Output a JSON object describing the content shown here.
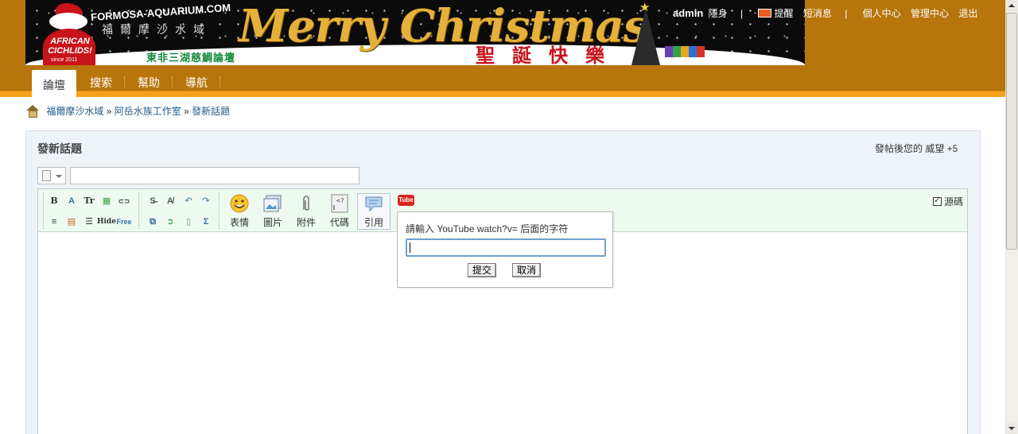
{
  "banner": {
    "site_url": "FORMOSA-AQUARIUM.COM",
    "site_name_cn": "福爾摩沙水域",
    "logo_text": "AFRICAN CICHLIDS!",
    "logo_since": "since 2011",
    "headline": "Merry Christmas",
    "forum_name": "東非三湖慈鯛論壇",
    "holiday_cn": "聖誕快樂"
  },
  "topnav": {
    "username": "admin",
    "invisible": "隱身",
    "reminders": "提醒",
    "messages": "短消息",
    "profile": "個人中心",
    "admin_center": "管理中心",
    "logout": "退出"
  },
  "nav": {
    "tabs": [
      {
        "label": "論壇"
      },
      {
        "label": "搜索"
      },
      {
        "label": "幫助"
      },
      {
        "label": "導航"
      }
    ]
  },
  "breadcrumb": {
    "items": [
      "福爾摩沙水域",
      "阿岳水族工作室",
      "發新話題"
    ],
    "sep": "»"
  },
  "page": {
    "title": "發新話題",
    "credit_note": "發帖後您的 威望 +5",
    "subject_value": ""
  },
  "toolbar": {
    "row1": [
      "B",
      "A",
      "Tr",
      "▦",
      "⊂⊃"
    ],
    "row2": [
      "≡",
      "▤",
      "☰",
      "Hide",
      "Free"
    ],
    "big_buttons": [
      {
        "label": "表情",
        "icon": "smiley-icon"
      },
      {
        "label": "圖片",
        "icon": "image-icon"
      },
      {
        "label": "附件",
        "icon": "paperclip-icon"
      },
      {
        "label": "代碼",
        "icon": "code-icon"
      },
      {
        "label": "引用",
        "icon": "quote-icon"
      }
    ],
    "youtube_icon": "Tube",
    "source_label": "源碼"
  },
  "popup": {
    "prompt": "請輸入 YouTube watch?v= 后面的字符",
    "input_value": "",
    "submit_label": "提交",
    "cancel_label": "取消"
  },
  "colors": {
    "header": "#b7750b",
    "header_accent": "#f4a21b",
    "toolbar_bg": "#eefaf0",
    "panel_bg": "#eef3f8",
    "link": "#1c5a8a"
  }
}
